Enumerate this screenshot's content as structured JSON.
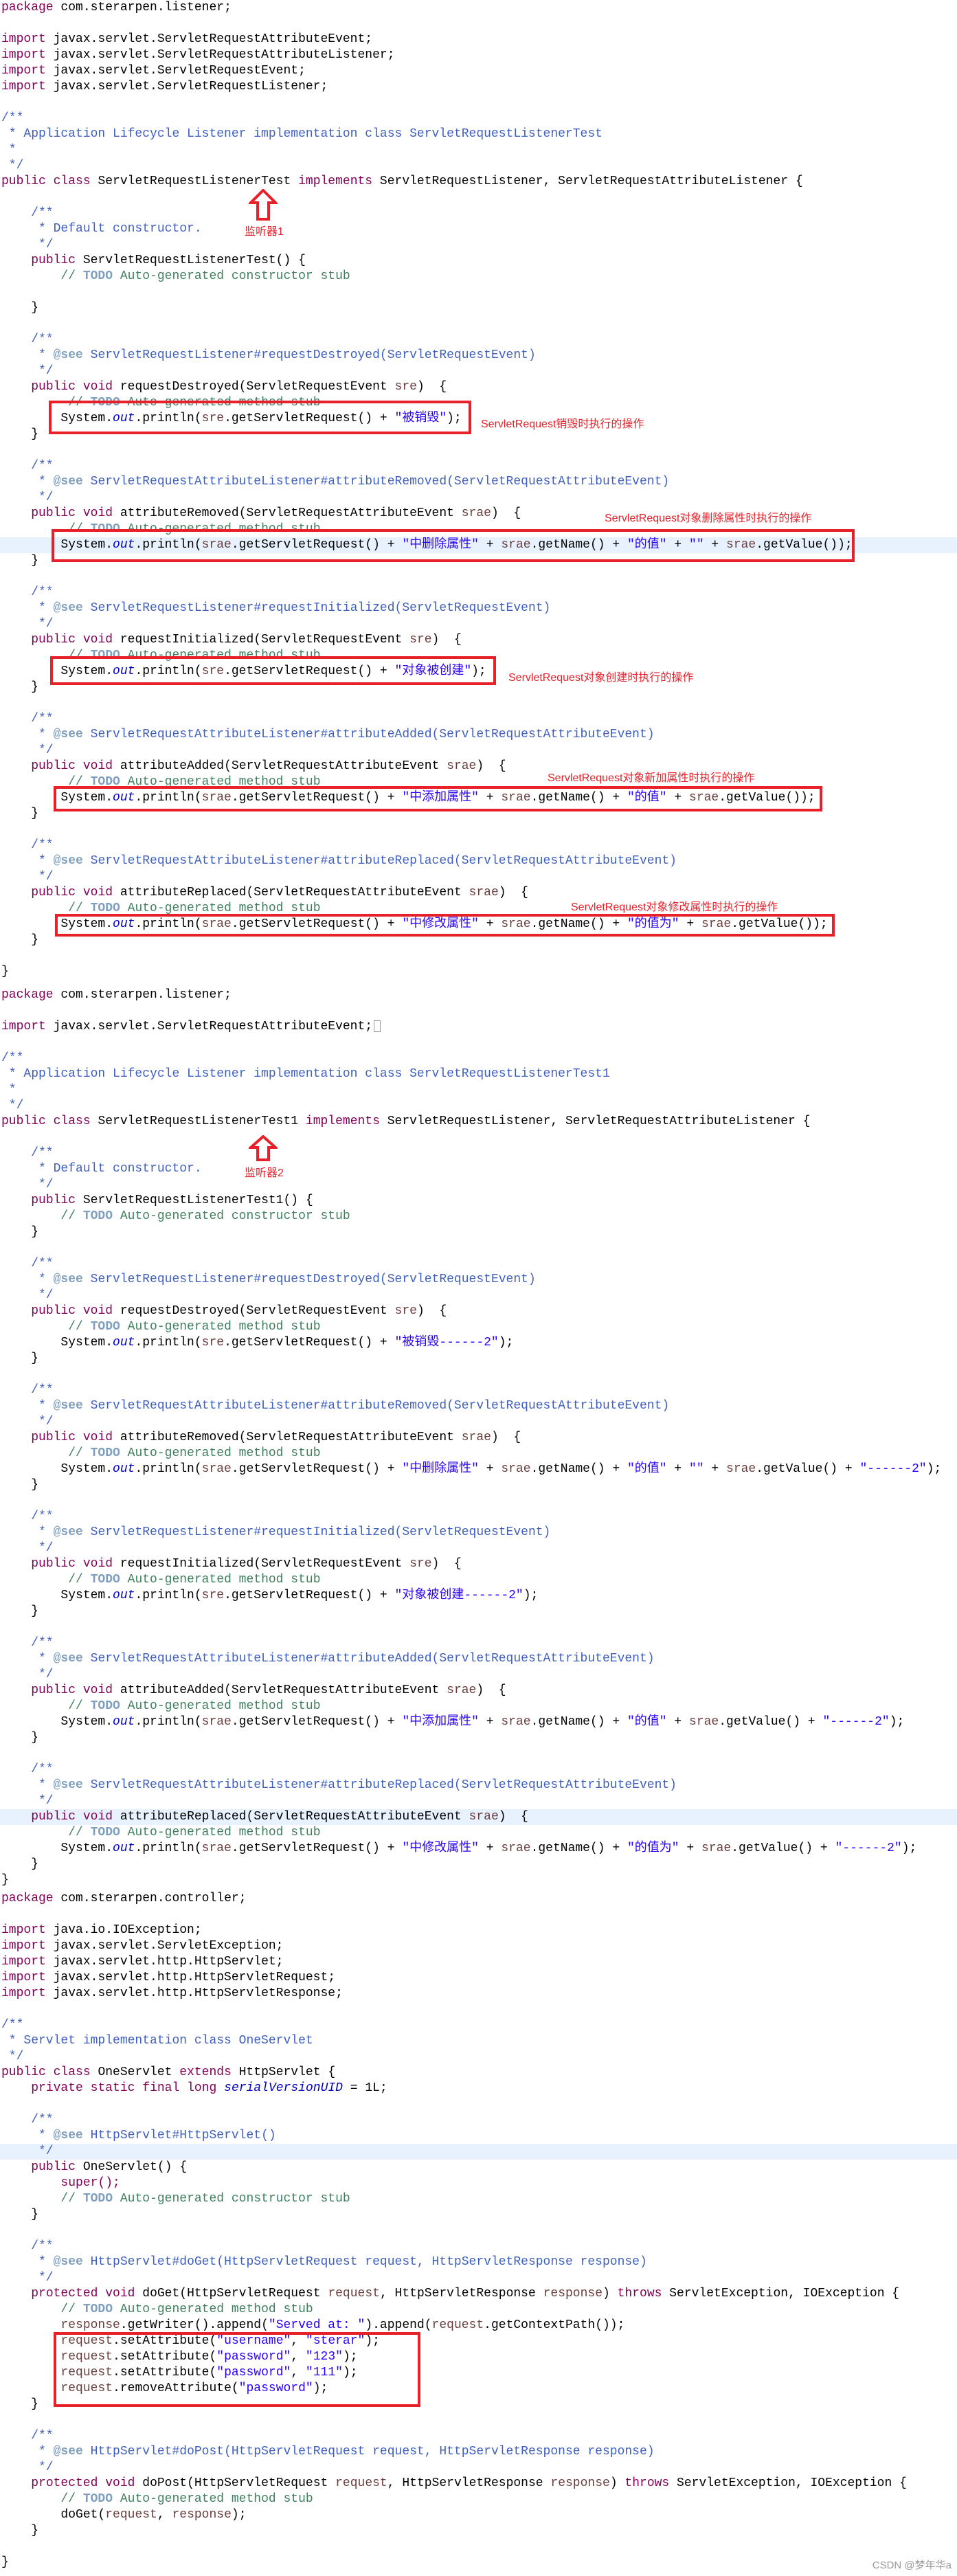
{
  "sections": [
    {
      "name": "ServletRequestListenerTest",
      "highlight_line": 34,
      "lines": [
        "package com.sterarpen.listener;",
        "",
        "import javax.servlet.ServletRequestAttributeEvent;",
        "import javax.servlet.ServletRequestAttributeListener;",
        "import javax.servlet.ServletRequestEvent;",
        "import javax.servlet.ServletRequestListener;",
        "",
        "/**",
        " * Application Lifecycle Listener implementation class ServletRequestListenerTest",
        " *",
        " */",
        "public class ServletRequestListenerTest implements ServletRequestListener, ServletRequestAttributeListener {",
        "",
        "    /**",
        "     * Default constructor. ",
        "     */",
        "    public ServletRequestListenerTest() {",
        "        // TODO Auto-generated constructor stub",
        "",
        "    }",
        "",
        "    /**",
        "     * @see ServletRequestListener#requestDestroyed(ServletRequestEvent)",
        "     */",
        "    public void requestDestroyed(ServletRequestEvent sre)  { ",
        "         // TODO Auto-generated method stub",
        "        System.out.println(sre.getServletRequest() + \"被销毁\");",
        "    }",
        "",
        "    /**",
        "     * @see ServletRequestAttributeListener#attributeRemoved(ServletRequestAttributeEvent)",
        "     */",
        "    public void attributeRemoved(ServletRequestAttributeEvent srae)  { ",
        "         // TODO Auto-generated method stub",
        "        System.out.println(srae.getServletRequest() + \"中删除属性\" + srae.getName() + \"的值\" + \"\" + srae.getValue());",
        "    }",
        "",
        "    /**",
        "     * @see ServletRequestListener#requestInitialized(ServletRequestEvent)",
        "     */",
        "    public void requestInitialized(ServletRequestEvent sre)  { ",
        "         // TODO Auto-generated method stub",
        "        System.out.println(sre.getServletRequest() + \"对象被创建\");",
        "    }",
        "",
        "    /**",
        "     * @see ServletRequestAttributeListener#attributeAdded(ServletRequestAttributeEvent)",
        "     */",
        "    public void attributeAdded(ServletRequestAttributeEvent srae)  { ",
        "         // TODO Auto-generated method stub",
        "        System.out.println(srae.getServletRequest() + \"中添加属性\" + srae.getName() + \"的值\" + srae.getValue());",
        "    }",
        "",
        "    /**",
        "     * @see ServletRequestAttributeListener#attributeReplaced(ServletRequestAttributeEvent)",
        "     */",
        "    public void attributeReplaced(ServletRequestAttributeEvent srae)  { ",
        "         // TODO Auto-generated method stub",
        "        System.out.println(srae.getServletRequest() + \"中修改属性\" + srae.getName() + \"的值为\" + srae.getValue());",
        "    }",
        "",
        "}"
      ]
    },
    {
      "name": "ServletRequestListenerTest1",
      "highlight_line": 52,
      "fold_line": 2,
      "lines": [
        "package com.sterarpen.listener;",
        "",
        "import javax.servlet.ServletRequestAttributeEvent;",
        "",
        "/**",
        " * Application Lifecycle Listener implementation class ServletRequestListenerTest1",
        " *",
        " */",
        "public class ServletRequestListenerTest1 implements ServletRequestListener, ServletRequestAttributeListener {",
        "",
        "    /**",
        "     * Default constructor. ",
        "     */",
        "    public ServletRequestListenerTest1() {",
        "        // TODO Auto-generated constructor stub",
        "    }",
        "",
        "    /**",
        "     * @see ServletRequestListener#requestDestroyed(ServletRequestEvent)",
        "     */",
        "    public void requestDestroyed(ServletRequestEvent sre)  { ",
        "         // TODO Auto-generated method stub",
        "        System.out.println(sre.getServletRequest() + \"被销毁------2\");",
        "    }",
        "",
        "    /**",
        "     * @see ServletRequestAttributeListener#attributeRemoved(ServletRequestAttributeEvent)",
        "     */",
        "    public void attributeRemoved(ServletRequestAttributeEvent srae)  { ",
        "         // TODO Auto-generated method stub",
        "        System.out.println(srae.getServletRequest() + \"中删除属性\" + srae.getName() + \"的值\" + \"\" + srae.getValue() + \"------2\");",
        "    }",
        "",
        "    /**",
        "     * @see ServletRequestListener#requestInitialized(ServletRequestEvent)",
        "     */",
        "    public void requestInitialized(ServletRequestEvent sre)  { ",
        "         // TODO Auto-generated method stub",
        "        System.out.println(sre.getServletRequest() + \"对象被创建------2\");",
        "    }",
        "",
        "    /**",
        "     * @see ServletRequestAttributeListener#attributeAdded(ServletRequestAttributeEvent)",
        "     */",
        "    public void attributeAdded(ServletRequestAttributeEvent srae)  { ",
        "         // TODO Auto-generated method stub",
        "        System.out.println(srae.getServletRequest() + \"中添加属性\" + srae.getName() + \"的值\" + srae.getValue() + \"------2\");",
        "    }",
        "",
        "    /**",
        "     * @see ServletRequestAttributeListener#attributeReplaced(ServletRequestAttributeEvent)",
        "     */",
        "    public void attributeReplaced(ServletRequestAttributeEvent srae)  { ",
        "         // TODO Auto-generated method stub",
        "        System.out.println(srae.getServletRequest() + \"中修改属性\" + srae.getName() + \"的值为\" + srae.getValue() + \"------2\");",
        "    }",
        "}"
      ]
    },
    {
      "name": "OneServlet",
      "highlight_line": 16,
      "lines": [
        "package com.sterarpen.controller;",
        "",
        "import java.io.IOException;",
        "import javax.servlet.ServletException;",
        "import javax.servlet.http.HttpServlet;",
        "import javax.servlet.http.HttpServletRequest;",
        "import javax.servlet.http.HttpServletResponse;",
        "",
        "/**",
        " * Servlet implementation class OneServlet",
        " */",
        "public class OneServlet extends HttpServlet {",
        "    private static final long serialVersionUID = 1L;",
        "",
        "    /**",
        "     * @see HttpServlet#HttpServlet()",
        "     */",
        "    public OneServlet() {",
        "        super();",
        "        // TODO Auto-generated constructor stub",
        "    }",
        "",
        "    /**",
        "     * @see HttpServlet#doGet(HttpServletRequest request, HttpServletResponse response)",
        "     */",
        "    protected void doGet(HttpServletRequest request, HttpServletResponse response) throws ServletException, IOException {",
        "        // TODO Auto-generated method stub",
        "        response.getWriter().append(\"Served at: \").append(request.getContextPath());",
        "        request.setAttribute(\"username\", \"sterar\");",
        "        request.setAttribute(\"password\", \"123\");",
        "        request.setAttribute(\"password\", \"111\");",
        "        request.removeAttribute(\"password\");",
        "    }",
        "",
        "    /**",
        "     * @see HttpServlet#doPost(HttpServletRequest request, HttpServletResponse response)",
        "     */",
        "    protected void doPost(HttpServletRequest request, HttpServletResponse response) throws ServletException, IOException {",
        "        // TODO Auto-generated method stub",
        "        doGet(request, response);",
        "    }",
        "",
        "}"
      ]
    }
  ],
  "annotations": {
    "listener1": "监听器1",
    "listener2": "监听器2",
    "destroyed": "ServletRequest销毁时执行的操作",
    "removed": "ServletRequest对象删除属性时执行的操作",
    "created": "ServletRequest对象创建时执行的操作",
    "added": "ServletRequest对象新加属性时执行的操作",
    "replaced": "ServletRequest对象修改属性时执行的操作"
  },
  "watermark": "CSDN @梦年华a",
  "colors": {
    "annotation_red": "#e8202a",
    "keyword": "#7f0055",
    "string": "#2a00ff",
    "javadoc": "#3f5fbf",
    "comment": "#3f7f5f",
    "line_highlight": "#e8f2fe"
  }
}
